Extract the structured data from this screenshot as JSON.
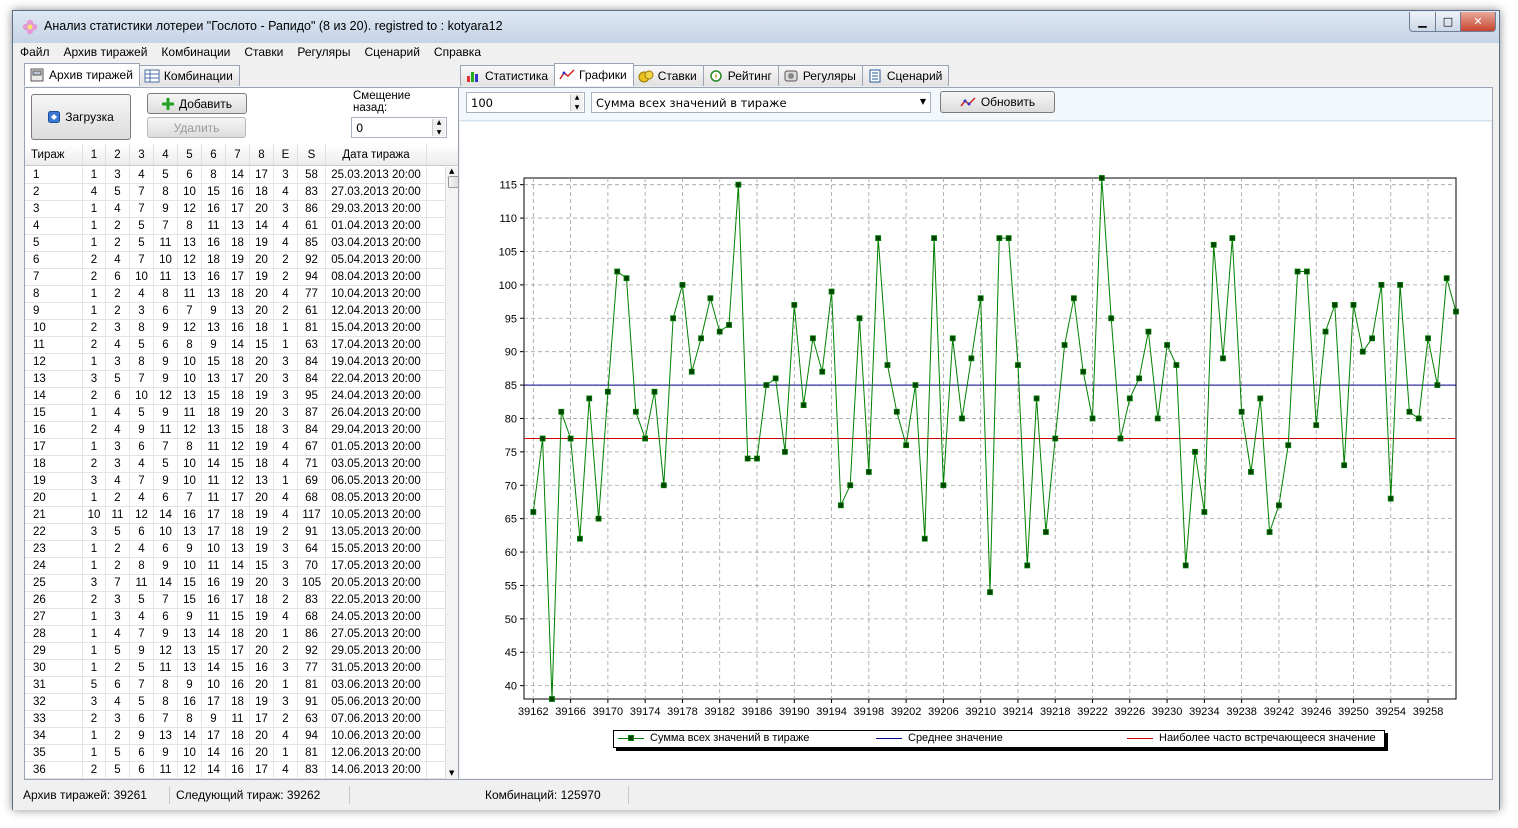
{
  "window": {
    "title": "Анализ статистики лотереи \"Гослото - Рапидо\" (8 из 20). registred to : kotyara12",
    "min": "▁",
    "max": "□",
    "close": "✕"
  },
  "menu": [
    "Файл",
    "Архив тиражей",
    "Комбинации",
    "Ставки",
    "Регуляры",
    "Сценарий",
    "Справка"
  ],
  "left_tabs": [
    {
      "label": "Архив тиражей",
      "icon": "archive-icon",
      "active": true
    },
    {
      "label": "Комбинации",
      "icon": "table-icon",
      "active": false
    }
  ],
  "archive": {
    "load_label": "Загрузка",
    "add_label": "Добавить",
    "delete_label": "Удалить",
    "offset_label": "Смещение назад:",
    "offset_value": "0",
    "columns": [
      "Тираж",
      "1",
      "2",
      "3",
      "4",
      "5",
      "6",
      "7",
      "8",
      "E",
      "S",
      "Дата тиража"
    ],
    "rows": [
      [
        "1",
        "1",
        "3",
        "4",
        "5",
        "6",
        "8",
        "14",
        "17",
        "3",
        "58",
        "25.03.2013 20:00"
      ],
      [
        "2",
        "4",
        "5",
        "7",
        "8",
        "10",
        "15",
        "16",
        "18",
        "4",
        "83",
        "27.03.2013 20:00"
      ],
      [
        "3",
        "1",
        "4",
        "7",
        "9",
        "12",
        "16",
        "17",
        "20",
        "3",
        "86",
        "29.03.2013 20:00"
      ],
      [
        "4",
        "1",
        "2",
        "5",
        "7",
        "8",
        "11",
        "13",
        "14",
        "4",
        "61",
        "01.04.2013 20:00"
      ],
      [
        "5",
        "1",
        "2",
        "5",
        "11",
        "13",
        "16",
        "18",
        "19",
        "4",
        "85",
        "03.04.2013 20:00"
      ],
      [
        "6",
        "2",
        "4",
        "7",
        "10",
        "12",
        "18",
        "19",
        "20",
        "2",
        "92",
        "05.04.2013 20:00"
      ],
      [
        "7",
        "2",
        "6",
        "10",
        "11",
        "13",
        "16",
        "17",
        "19",
        "2",
        "94",
        "08.04.2013 20:00"
      ],
      [
        "8",
        "1",
        "2",
        "4",
        "8",
        "11",
        "13",
        "18",
        "20",
        "4",
        "77",
        "10.04.2013 20:00"
      ],
      [
        "9",
        "1",
        "2",
        "3",
        "6",
        "7",
        "9",
        "13",
        "20",
        "2",
        "61",
        "12.04.2013 20:00"
      ],
      [
        "10",
        "2",
        "3",
        "8",
        "9",
        "12",
        "13",
        "16",
        "18",
        "1",
        "81",
        "15.04.2013 20:00"
      ],
      [
        "11",
        "2",
        "4",
        "5",
        "6",
        "8",
        "9",
        "14",
        "15",
        "1",
        "63",
        "17.04.2013 20:00"
      ],
      [
        "12",
        "1",
        "3",
        "8",
        "9",
        "10",
        "15",
        "18",
        "20",
        "3",
        "84",
        "19.04.2013 20:00"
      ],
      [
        "13",
        "3",
        "5",
        "7",
        "9",
        "10",
        "13",
        "17",
        "20",
        "3",
        "84",
        "22.04.2013 20:00"
      ],
      [
        "14",
        "2",
        "6",
        "10",
        "12",
        "13",
        "15",
        "18",
        "19",
        "3",
        "95",
        "24.04.2013 20:00"
      ],
      [
        "15",
        "1",
        "4",
        "5",
        "9",
        "11",
        "18",
        "19",
        "20",
        "3",
        "87",
        "26.04.2013 20:00"
      ],
      [
        "16",
        "2",
        "4",
        "9",
        "11",
        "12",
        "13",
        "15",
        "18",
        "3",
        "84",
        "29.04.2013 20:00"
      ],
      [
        "17",
        "1",
        "3",
        "6",
        "7",
        "8",
        "11",
        "12",
        "19",
        "4",
        "67",
        "01.05.2013 20:00"
      ],
      [
        "18",
        "2",
        "3",
        "4",
        "5",
        "10",
        "14",
        "15",
        "18",
        "4",
        "71",
        "03.05.2013 20:00"
      ],
      [
        "19",
        "3",
        "4",
        "7",
        "9",
        "10",
        "11",
        "12",
        "13",
        "1",
        "69",
        "06.05.2013 20:00"
      ],
      [
        "20",
        "1",
        "2",
        "4",
        "6",
        "7",
        "11",
        "17",
        "20",
        "4",
        "68",
        "08.05.2013 20:00"
      ],
      [
        "21",
        "10",
        "11",
        "12",
        "14",
        "16",
        "17",
        "18",
        "19",
        "4",
        "117",
        "10.05.2013 20:00"
      ],
      [
        "22",
        "3",
        "5",
        "6",
        "10",
        "13",
        "17",
        "18",
        "19",
        "2",
        "91",
        "13.05.2013 20:00"
      ],
      [
        "23",
        "1",
        "2",
        "4",
        "6",
        "9",
        "10",
        "13",
        "19",
        "3",
        "64",
        "15.05.2013 20:00"
      ],
      [
        "24",
        "1",
        "2",
        "8",
        "9",
        "10",
        "11",
        "14",
        "15",
        "3",
        "70",
        "17.05.2013 20:00"
      ],
      [
        "25",
        "3",
        "7",
        "11",
        "14",
        "15",
        "16",
        "19",
        "20",
        "3",
        "105",
        "20.05.2013 20:00"
      ],
      [
        "26",
        "2",
        "3",
        "5",
        "7",
        "15",
        "16",
        "17",
        "18",
        "2",
        "83",
        "22.05.2013 20:00"
      ],
      [
        "27",
        "1",
        "3",
        "4",
        "6",
        "9",
        "11",
        "15",
        "19",
        "4",
        "68",
        "24.05.2013 20:00"
      ],
      [
        "28",
        "1",
        "4",
        "7",
        "9",
        "13",
        "14",
        "18",
        "20",
        "1",
        "86",
        "27.05.2013 20:00"
      ],
      [
        "29",
        "1",
        "5",
        "9",
        "12",
        "13",
        "15",
        "17",
        "20",
        "2",
        "92",
        "29.05.2013 20:00"
      ],
      [
        "30",
        "1",
        "2",
        "5",
        "11",
        "13",
        "14",
        "15",
        "16",
        "3",
        "77",
        "31.05.2013 20:00"
      ],
      [
        "31",
        "5",
        "6",
        "7",
        "8",
        "9",
        "10",
        "16",
        "20",
        "1",
        "81",
        "03.06.2013 20:00"
      ],
      [
        "32",
        "3",
        "4",
        "5",
        "8",
        "16",
        "17",
        "18",
        "19",
        "3",
        "91",
        "05.06.2013 20:00"
      ],
      [
        "33",
        "2",
        "3",
        "6",
        "7",
        "8",
        "9",
        "11",
        "17",
        "2",
        "63",
        "07.06.2013 20:00"
      ],
      [
        "34",
        "1",
        "2",
        "9",
        "13",
        "14",
        "17",
        "18",
        "20",
        "4",
        "94",
        "10.06.2013 20:00"
      ],
      [
        "35",
        "1",
        "5",
        "6",
        "9",
        "10",
        "14",
        "16",
        "20",
        "1",
        "81",
        "12.06.2013 20:00"
      ],
      [
        "36",
        "2",
        "5",
        "6",
        "11",
        "12",
        "14",
        "16",
        "17",
        "4",
        "83",
        "14.06.2013 20:00"
      ]
    ]
  },
  "right_tabs": [
    {
      "label": "Статистика",
      "icon": "bar-chart-icon",
      "active": false
    },
    {
      "label": "Графики",
      "icon": "line-chart-icon",
      "active": true
    },
    {
      "label": "Ставки",
      "icon": "coins-icon",
      "active": false
    },
    {
      "label": "Рейтинг",
      "icon": "rating-icon",
      "active": false
    },
    {
      "label": "Регуляры",
      "icon": "regulars-icon",
      "active": false
    },
    {
      "label": "Сценарий",
      "icon": "script-icon",
      "active": false
    }
  ],
  "graph_controls": {
    "count_value": "100",
    "series_select": "Сумма всех значений в тираже",
    "refresh_label": "Обновить"
  },
  "chart_data": {
    "type": "line",
    "xlabel": "",
    "ylabel": "",
    "xlim": [
      39161,
      39261
    ],
    "ylim": [
      38,
      116
    ],
    "x_ticks": [
      39162,
      39166,
      39170,
      39174,
      39178,
      39182,
      39186,
      39190,
      39194,
      39198,
      39202,
      39206,
      39210,
      39214,
      39218,
      39222,
      39226,
      39230,
      39234,
      39238,
      39242,
      39246,
      39250,
      39254,
      39258
    ],
    "y_ticks": [
      40,
      45,
      50,
      55,
      60,
      65,
      70,
      75,
      80,
      85,
      90,
      95,
      100,
      105,
      110,
      115
    ],
    "grid": true,
    "legend_position": "bottom",
    "series": [
      {
        "name": "Сумма всех значений в тираже",
        "color": "#008000",
        "marker": "square",
        "x_start": 39162,
        "values": [
          66,
          77,
          38,
          81,
          77,
          62,
          83,
          65,
          84,
          102,
          101,
          81,
          77,
          84,
          70,
          95,
          100,
          87,
          92,
          98,
          93,
          94,
          115,
          74,
          74,
          85,
          86,
          75,
          97,
          82,
          92,
          87,
          99,
          67,
          70,
          95,
          72,
          107,
          88,
          81,
          76,
          85,
          62,
          107,
          70,
          92,
          80,
          89,
          98,
          54,
          107,
          107,
          88,
          58,
          83,
          63,
          77,
          91,
          98,
          87,
          80,
          116,
          95,
          77,
          83,
          86,
          93,
          80,
          91,
          88,
          58,
          75,
          66,
          106,
          89,
          107,
          81,
          72,
          83,
          63,
          67,
          76,
          102,
          102,
          79,
          93,
          97,
          73,
          97,
          90,
          92,
          100,
          68,
          100,
          81,
          80,
          92,
          85,
          101,
          96
        ]
      },
      {
        "name": "Среднее значение",
        "color": "#00008b",
        "constant": 85
      },
      {
        "name": "Наиболее часто встречающееся значение",
        "color": "#cc0000",
        "constant": 77
      }
    ]
  },
  "status": {
    "archive": "Архив тиражей: 39261",
    "next": "Следующий тираж: 39262",
    "combos": "Комбинаций: 125970"
  }
}
